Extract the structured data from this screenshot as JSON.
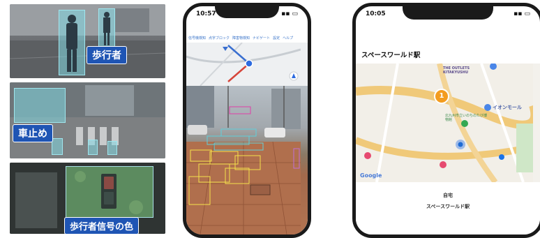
{
  "panels": {
    "pedestrian_label": "歩行者",
    "bollard_label": "車止め",
    "signal_label": "歩行者信号の色"
  },
  "phone_nav": {
    "time": "10:57",
    "tabs": [
      "信号機検知",
      "点字ブロック",
      "障害物検知",
      "ナビゲート",
      "設定",
      "ヘルプ"
    ]
  },
  "phone_map": {
    "time": "10:05",
    "station_title": "スペースワールド駅",
    "map_labels": {
      "place1": "THE OUTLETS KITAKYUSHU",
      "place2": "イオンモール",
      "place3": "北九州市立いのちのたび博物館",
      "google": "Google",
      "marker_number": "1"
    },
    "info_line1": "自宅",
    "info_line2": "スペースワールド駅"
  }
}
